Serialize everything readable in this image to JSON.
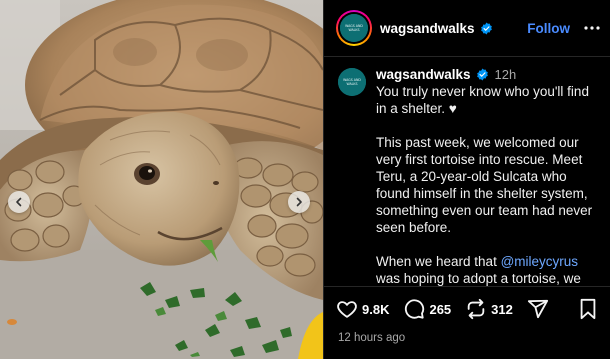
{
  "post": {
    "username": "wagsandwalks",
    "avatar_text": "WAGS AND WALKS",
    "follow_label": "Follow",
    "caption_time": "12h",
    "caption_paragraphs": [
      "You truly never know who you'll find in a shelter. ♥",
      "This past week, we welcomed our very first tortoise into rescue. Meet Teru, a 20-year-old Sulcata who found himself in the shelter system, something even our team had never seen before."
    ],
    "caption_p3_mention": "@mileycyrus",
    "caption_p3_text": " was hoping to adopt a tortoise, we knew we had to help make the connection happen. After a little coordination, the",
    "caption_p3_prefix": "When we heard that ",
    "likes": "9.8K",
    "comments": "265",
    "reposts": "312",
    "timestamp": "12 hours ago"
  },
  "icons": {
    "verified": "verified-badge-icon",
    "more": "more-options-icon",
    "like": "heart-icon",
    "comment": "comment-icon",
    "repost": "repost-icon",
    "share": "share-icon",
    "save": "bookmark-icon",
    "prev": "chevron-left-icon",
    "next": "chevron-right-icon"
  },
  "colors": {
    "avatar_bg": "#0d6f73",
    "verified_blue": "#0095f6",
    "follow_blue": "#4a8bff",
    "mention_blue": "#6ea8ff"
  }
}
